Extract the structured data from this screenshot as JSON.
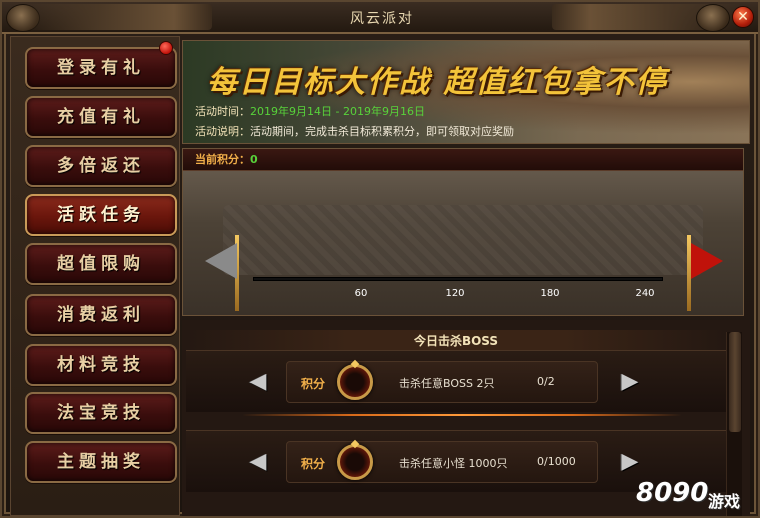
{
  "window": {
    "title": "风云派对",
    "close_glyph": "✕"
  },
  "sidebar": {
    "items": [
      {
        "label": "登录有礼",
        "active": false,
        "has_dot": true
      },
      {
        "label": "充值有礼",
        "active": false,
        "has_dot": false
      },
      {
        "label": "多倍返还",
        "active": false,
        "has_dot": false
      },
      {
        "label": "活跃任务",
        "active": true,
        "has_dot": false
      },
      {
        "label": "超值限购",
        "active": false,
        "has_dot": false
      },
      {
        "label": "消费返利",
        "active": false,
        "has_dot": false
      },
      {
        "label": "材料竞技",
        "active": false,
        "has_dot": false
      },
      {
        "label": "法宝竞技",
        "active": false,
        "has_dot": false
      },
      {
        "label": "主题抽奖",
        "active": false,
        "has_dot": false
      }
    ]
  },
  "banner": {
    "title": "每日目标大作战  超值红包拿不停",
    "time_label": "活动时间：",
    "time_value": "2019年9月14日 - 2019年9月16日",
    "desc_label": "活动说明：",
    "desc_value": "活动期间，完成击杀目标积累积分，即可领取对应奖励"
  },
  "progress": {
    "current_label": "当前积分：",
    "current_value": "0",
    "current_points": 0,
    "max_points": 240,
    "ticks": [
      "60",
      "120",
      "180",
      "240"
    ]
  },
  "tasks": {
    "header": "今日击杀BOSS",
    "rows": [
      {
        "points_label": "积分",
        "desc": "击杀任意BOSS 2只",
        "count": "0/2"
      },
      {
        "points_label": "积分",
        "desc": "击杀任意小怪 1000只",
        "count": "0/1000"
      }
    ],
    "prev_glyph": "◀",
    "next_glyph": "▶"
  },
  "watermark": {
    "digits": "8090",
    "text": "游戏"
  }
}
